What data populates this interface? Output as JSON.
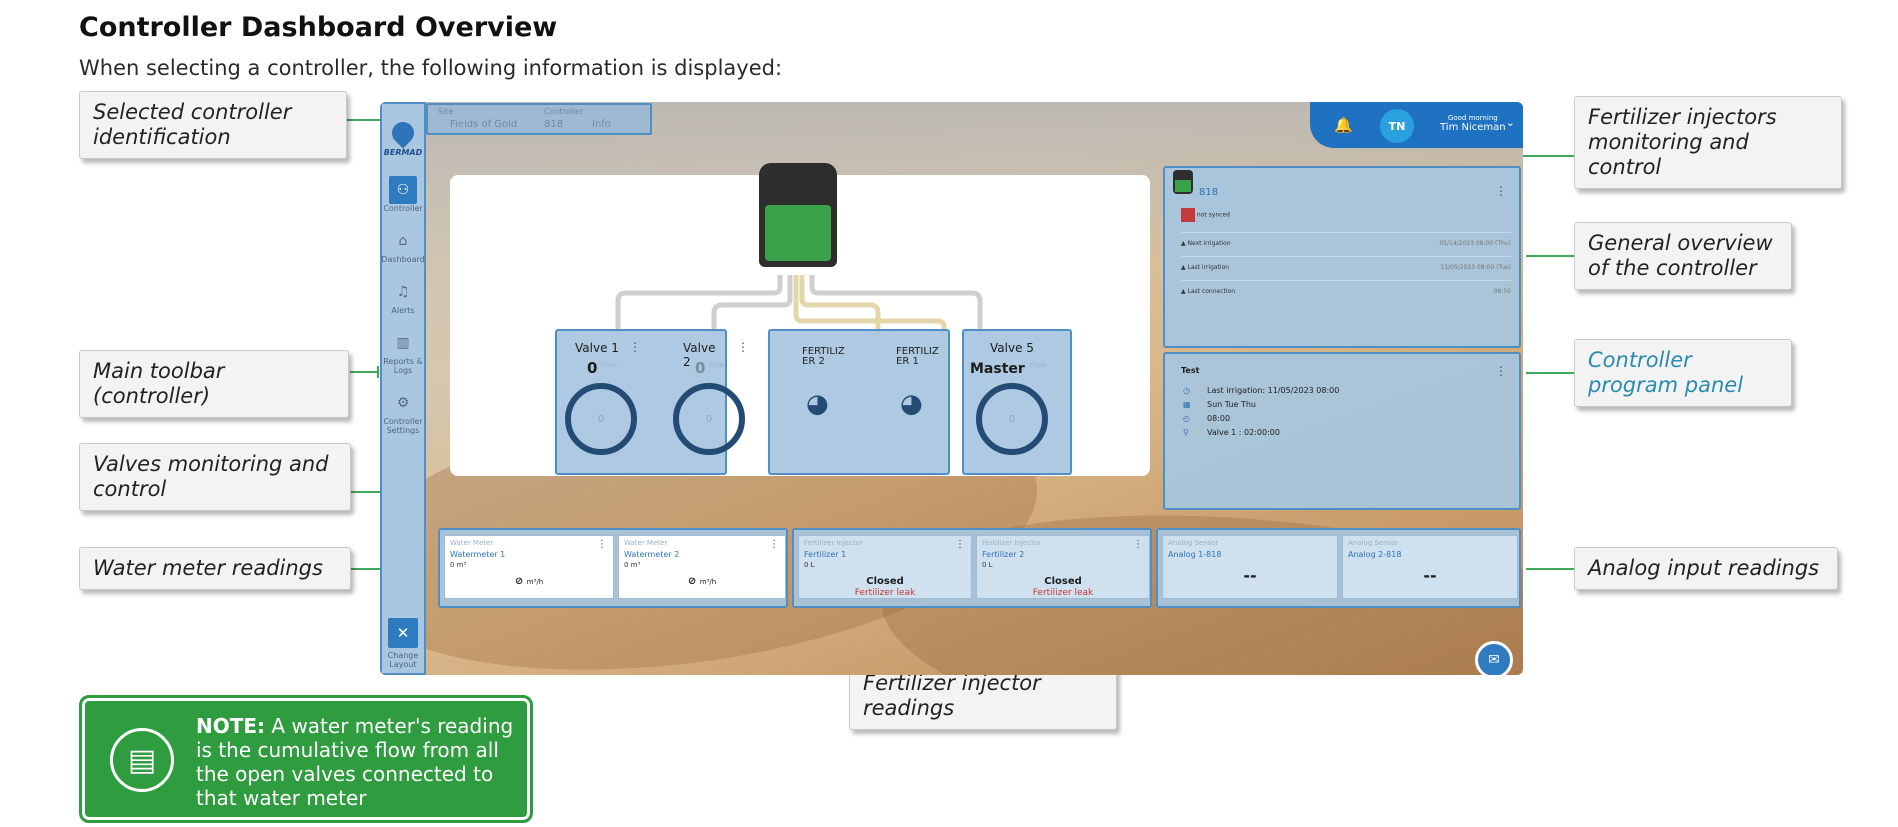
{
  "doc": {
    "title": "Controller Dashboard Overview",
    "intro": "When selecting a controller, the following information is displayed:"
  },
  "callouts": {
    "selected_id": "Selected controller identification",
    "toolbar": "Main toolbar (controller)",
    "valves": "Valves monitoring and control",
    "water_meter": "Water meter readings",
    "fert_inj": "Fertilizer injector readings",
    "fert_mon": "Fertilizer injectors monitoring and control",
    "general": "General overview of the controller",
    "program": "Controller program panel",
    "analog": "Analog input readings"
  },
  "app": {
    "sidebar": {
      "logo": "BERMAD",
      "items": [
        {
          "label": "Controller"
        },
        {
          "label": "Dashboard"
        },
        {
          "label": "Alerts"
        },
        {
          "label": "Reports & Logs"
        },
        {
          "label": "Controller Settings"
        }
      ],
      "bottom_label": "Change Layout"
    },
    "id_box": {
      "site_label": "Site",
      "site_value": "Fields of Gold",
      "controller_label": "Controller",
      "controller_value": "818",
      "info": "Info"
    },
    "header": {
      "initials": "TN",
      "greeting": "Good morning",
      "user": "Tim Niceman"
    },
    "valves": [
      {
        "name": "Valve 1",
        "value": "0",
        "gauge": "0"
      },
      {
        "name": "Valve 2",
        "value": "0",
        "gauge": "0"
      }
    ],
    "flow_label": "Flow",
    "fertilizers": [
      {
        "name": "FERTILIZ ER 2"
      },
      {
        "name": "FERTILIZ ER 1"
      }
    ],
    "valve5": {
      "name": "Valve 5",
      "master": "Master",
      "gauge": "0"
    },
    "overview": {
      "name": "818",
      "status": "not synced",
      "rows": [
        {
          "label": "Next irrigation",
          "value": "05/14/2023 08:00 (Thu)"
        },
        {
          "label": "Last irrigation",
          "value": "11/05/2023 08:00 (Tue)"
        },
        {
          "label": "Last connection",
          "value": "08:50"
        }
      ]
    },
    "program": {
      "name": "Test",
      "last": "Last irrigation: 11/05/2023 08:00",
      "days": "Sun  Tue  Thu",
      "time": "08:00",
      "valve": "Valve 1 : 02:00:00"
    },
    "tiles": {
      "wm1": {
        "type": "Water Meter",
        "name": "Watermeter 1",
        "value": "0 m³",
        "unit": "m³/h"
      },
      "wm2": {
        "type": "Water Meter",
        "name": "Watermeter 2",
        "value": "0 m³",
        "unit": "m³/h"
      },
      "fi1": {
        "type": "Fertilizer Injector",
        "name": "Fertilizer 1",
        "value": "0 L",
        "main": "Closed",
        "sub": "Fertilizer leak"
      },
      "fi2": {
        "type": "Fertilizer Injector",
        "name": "Fertilizer 2",
        "value": "0 L",
        "main": "Closed",
        "sub": "Fertilizer leak"
      },
      "an1": {
        "type": "Analog Sensor",
        "name": "Analog 1-818",
        "main": "--"
      },
      "an2": {
        "type": "Analog Sensor",
        "name": "Analog 2-818",
        "main": "--"
      }
    }
  },
  "note": {
    "label": "NOTE:",
    "text": "A water meter's reading is the cumulative flow from all the open valves connected to that water meter"
  }
}
